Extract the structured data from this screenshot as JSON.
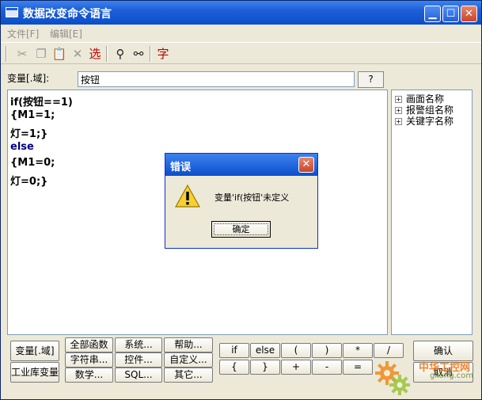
{
  "window": {
    "title": "数据改变命令语言"
  },
  "menubar": {
    "items": [
      "文件[F]",
      "编辑[E]"
    ]
  },
  "toolbar": {
    "select_label": "选",
    "font_label": "字"
  },
  "variable": {
    "label": "变量[.域]:",
    "value": "按钮",
    "help_label": "?"
  },
  "editor": {
    "lines": [
      "if(按钮==1)",
      "{M1=1;",
      "灯=1;}",
      "else",
      "{M1=0;",
      "灯=0;}"
    ]
  },
  "tree": {
    "items": [
      "画面名称",
      "报警组名称",
      "关键字名称"
    ]
  },
  "bottom": {
    "left_buttons": [
      "变量[.域]",
      "工业库变量"
    ],
    "func_buttons": [
      "全部函数",
      "系统...",
      "帮助...",
      "字符串...",
      "控件...",
      "自定义...",
      "数学...",
      "SQL...",
      "其它..."
    ],
    "op_buttons": [
      "if",
      "else",
      "(",
      ")",
      "*",
      "/",
      "{",
      "}",
      "+",
      "-",
      "="
    ],
    "confirm_label": "确认",
    "cancel_label": "取消"
  },
  "dialog": {
    "title": "错误",
    "message": "变量'if(按钮'未定义",
    "ok_label": "确定"
  },
  "watermark": {
    "text_cn": "中华工控网",
    "text_url": "gkong.com"
  }
}
